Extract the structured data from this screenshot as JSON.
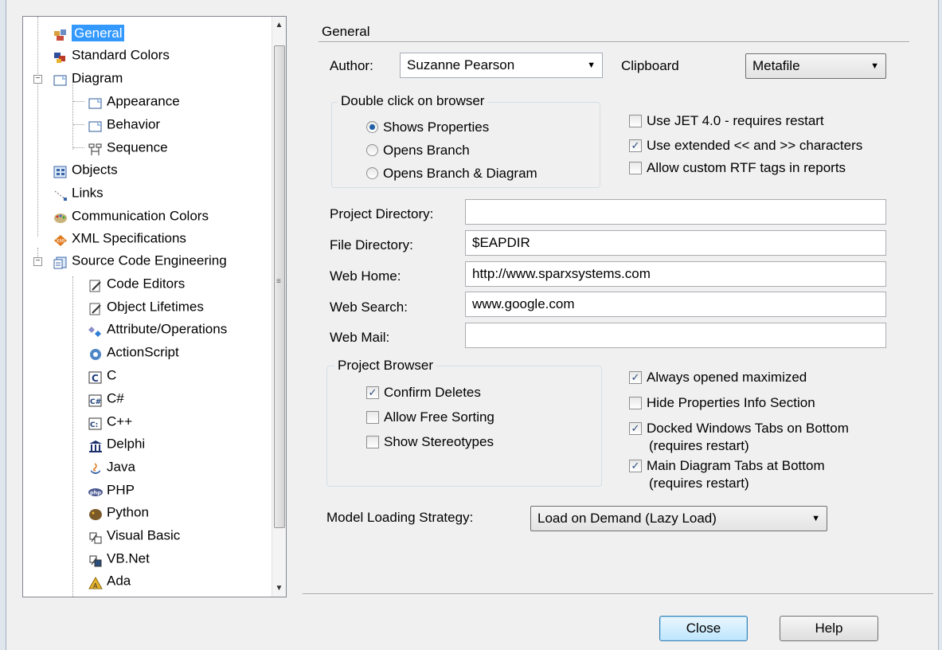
{
  "tree": {
    "items": [
      {
        "label": "General",
        "icon": "general-icon"
      },
      {
        "label": "Standard Colors",
        "icon": "colors-icon"
      },
      {
        "label": "Diagram",
        "icon": "diagram-icon"
      },
      {
        "label": "Appearance",
        "icon": "diagram-page-icon"
      },
      {
        "label": "Behavior",
        "icon": "diagram-page-icon"
      },
      {
        "label": "Sequence",
        "icon": "sequence-icon"
      },
      {
        "label": "Objects",
        "icon": "objects-icon"
      },
      {
        "label": "Links",
        "icon": "links-icon"
      },
      {
        "label": "Communication Colors",
        "icon": "palette-icon"
      },
      {
        "label": "XML Specifications",
        "icon": "xml-icon"
      },
      {
        "label": "Source Code Engineering",
        "icon": "source-code-icon"
      },
      {
        "label": "Code Editors",
        "icon": "edit-page-icon"
      },
      {
        "label": "Object Lifetimes",
        "icon": "edit-page-icon"
      },
      {
        "label": "Attribute/Operations",
        "icon": "attribute-icon"
      },
      {
        "label": "ActionScript",
        "icon": "actionscript-icon"
      },
      {
        "label": "C",
        "icon": "c-icon"
      },
      {
        "label": "C#",
        "icon": "csharp-icon"
      },
      {
        "label": "C++",
        "icon": "cpp-icon"
      },
      {
        "label": "Delphi",
        "icon": "delphi-icon"
      },
      {
        "label": "Java",
        "icon": "java-icon"
      },
      {
        "label": "PHP",
        "icon": "php-icon"
      },
      {
        "label": "Python",
        "icon": "python-icon"
      },
      {
        "label": "Visual Basic",
        "icon": "vb-icon"
      },
      {
        "label": "VB.Net",
        "icon": "vbnet-icon"
      },
      {
        "label": "Ada",
        "icon": "ada-icon"
      }
    ],
    "expander_collapse_glyph": "−",
    "scroll_up_glyph": "▲",
    "scroll_down_glyph": "▼",
    "thumb_grip": "≡"
  },
  "general": {
    "title": "General",
    "author_label": "Author:",
    "author_value": "Suzanne Pearson",
    "clipboard_label": "Clipboard",
    "clipboard_value": "Metafile",
    "double_click_title": "Double click on browser",
    "radios": [
      {
        "label": "Shows Properties",
        "checked": true
      },
      {
        "label": "Opens Branch",
        "checked": false
      },
      {
        "label": "Opens Branch  & Diagram",
        "checked": false
      }
    ],
    "options": [
      {
        "label": "Use JET 4.0 - requires restart",
        "checked": false
      },
      {
        "label": "Use extended << and >> characters",
        "checked": true
      },
      {
        "label": "Allow custom RTF tags in reports",
        "checked": false
      }
    ],
    "project_directory_label": "Project Directory:",
    "project_directory_value": "",
    "file_directory_label": "File Directory:",
    "file_directory_value": "$EAPDIR",
    "web_home_label": "Web Home:",
    "web_home_value": "http://www.sparxsystems.com",
    "web_search_label": "Web Search:",
    "web_search_value": "www.google.com",
    "web_mail_label": "Web Mail:",
    "web_mail_value": "",
    "project_browser_title": "Project Browser",
    "browser_checks": [
      {
        "label": "Confirm Deletes",
        "checked": true
      },
      {
        "label": "Allow Free Sorting",
        "checked": false
      },
      {
        "label": "Show Stereotypes",
        "checked": false
      }
    ],
    "window_checks": [
      {
        "label": "Always opened maximized",
        "checked": true
      },
      {
        "label": "Hide Properties Info Section",
        "checked": false
      },
      {
        "label": "Docked Windows Tabs on Bottom",
        "sub": "(requires restart)",
        "checked": true
      },
      {
        "label": "Main Diagram Tabs at Bottom",
        "sub": "(requires restart)",
        "checked": true
      }
    ],
    "model_loading_label": "Model Loading Strategy:",
    "model_loading_value": "Load on Demand (Lazy Load)",
    "dropdown_glyph": "▼",
    "check_glyph": "✓"
  },
  "buttons": {
    "close": "Close",
    "help": "Help"
  }
}
